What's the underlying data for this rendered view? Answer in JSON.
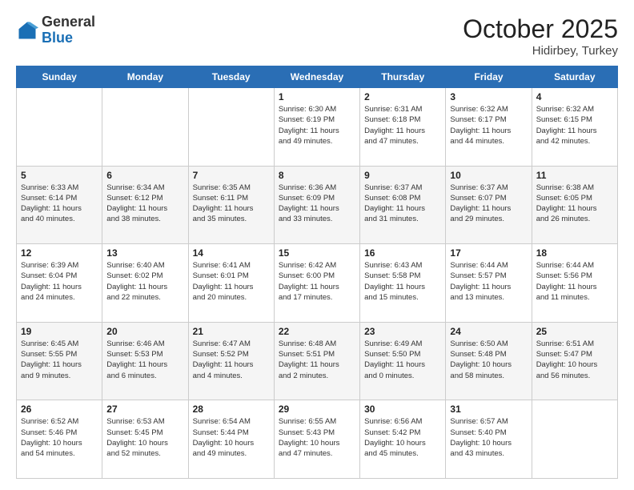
{
  "header": {
    "logo_general": "General",
    "logo_blue": "Blue",
    "month": "October 2025",
    "location": "Hidirbey, Turkey"
  },
  "days_of_week": [
    "Sunday",
    "Monday",
    "Tuesday",
    "Wednesday",
    "Thursday",
    "Friday",
    "Saturday"
  ],
  "weeks": [
    [
      {
        "day": "",
        "info": ""
      },
      {
        "day": "",
        "info": ""
      },
      {
        "day": "",
        "info": ""
      },
      {
        "day": "1",
        "info": "Sunrise: 6:30 AM\nSunset: 6:19 PM\nDaylight: 11 hours\nand 49 minutes."
      },
      {
        "day": "2",
        "info": "Sunrise: 6:31 AM\nSunset: 6:18 PM\nDaylight: 11 hours\nand 47 minutes."
      },
      {
        "day": "3",
        "info": "Sunrise: 6:32 AM\nSunset: 6:17 PM\nDaylight: 11 hours\nand 44 minutes."
      },
      {
        "day": "4",
        "info": "Sunrise: 6:32 AM\nSunset: 6:15 PM\nDaylight: 11 hours\nand 42 minutes."
      }
    ],
    [
      {
        "day": "5",
        "info": "Sunrise: 6:33 AM\nSunset: 6:14 PM\nDaylight: 11 hours\nand 40 minutes."
      },
      {
        "day": "6",
        "info": "Sunrise: 6:34 AM\nSunset: 6:12 PM\nDaylight: 11 hours\nand 38 minutes."
      },
      {
        "day": "7",
        "info": "Sunrise: 6:35 AM\nSunset: 6:11 PM\nDaylight: 11 hours\nand 35 minutes."
      },
      {
        "day": "8",
        "info": "Sunrise: 6:36 AM\nSunset: 6:09 PM\nDaylight: 11 hours\nand 33 minutes."
      },
      {
        "day": "9",
        "info": "Sunrise: 6:37 AM\nSunset: 6:08 PM\nDaylight: 11 hours\nand 31 minutes."
      },
      {
        "day": "10",
        "info": "Sunrise: 6:37 AM\nSunset: 6:07 PM\nDaylight: 11 hours\nand 29 minutes."
      },
      {
        "day": "11",
        "info": "Sunrise: 6:38 AM\nSunset: 6:05 PM\nDaylight: 11 hours\nand 26 minutes."
      }
    ],
    [
      {
        "day": "12",
        "info": "Sunrise: 6:39 AM\nSunset: 6:04 PM\nDaylight: 11 hours\nand 24 minutes."
      },
      {
        "day": "13",
        "info": "Sunrise: 6:40 AM\nSunset: 6:02 PM\nDaylight: 11 hours\nand 22 minutes."
      },
      {
        "day": "14",
        "info": "Sunrise: 6:41 AM\nSunset: 6:01 PM\nDaylight: 11 hours\nand 20 minutes."
      },
      {
        "day": "15",
        "info": "Sunrise: 6:42 AM\nSunset: 6:00 PM\nDaylight: 11 hours\nand 17 minutes."
      },
      {
        "day": "16",
        "info": "Sunrise: 6:43 AM\nSunset: 5:58 PM\nDaylight: 11 hours\nand 15 minutes."
      },
      {
        "day": "17",
        "info": "Sunrise: 6:44 AM\nSunset: 5:57 PM\nDaylight: 11 hours\nand 13 minutes."
      },
      {
        "day": "18",
        "info": "Sunrise: 6:44 AM\nSunset: 5:56 PM\nDaylight: 11 hours\nand 11 minutes."
      }
    ],
    [
      {
        "day": "19",
        "info": "Sunrise: 6:45 AM\nSunset: 5:55 PM\nDaylight: 11 hours\nand 9 minutes."
      },
      {
        "day": "20",
        "info": "Sunrise: 6:46 AM\nSunset: 5:53 PM\nDaylight: 11 hours\nand 6 minutes."
      },
      {
        "day": "21",
        "info": "Sunrise: 6:47 AM\nSunset: 5:52 PM\nDaylight: 11 hours\nand 4 minutes."
      },
      {
        "day": "22",
        "info": "Sunrise: 6:48 AM\nSunset: 5:51 PM\nDaylight: 11 hours\nand 2 minutes."
      },
      {
        "day": "23",
        "info": "Sunrise: 6:49 AM\nSunset: 5:50 PM\nDaylight: 11 hours\nand 0 minutes."
      },
      {
        "day": "24",
        "info": "Sunrise: 6:50 AM\nSunset: 5:48 PM\nDaylight: 10 hours\nand 58 minutes."
      },
      {
        "day": "25",
        "info": "Sunrise: 6:51 AM\nSunset: 5:47 PM\nDaylight: 10 hours\nand 56 minutes."
      }
    ],
    [
      {
        "day": "26",
        "info": "Sunrise: 6:52 AM\nSunset: 5:46 PM\nDaylight: 10 hours\nand 54 minutes."
      },
      {
        "day": "27",
        "info": "Sunrise: 6:53 AM\nSunset: 5:45 PM\nDaylight: 10 hours\nand 52 minutes."
      },
      {
        "day": "28",
        "info": "Sunrise: 6:54 AM\nSunset: 5:44 PM\nDaylight: 10 hours\nand 49 minutes."
      },
      {
        "day": "29",
        "info": "Sunrise: 6:55 AM\nSunset: 5:43 PM\nDaylight: 10 hours\nand 47 minutes."
      },
      {
        "day": "30",
        "info": "Sunrise: 6:56 AM\nSunset: 5:42 PM\nDaylight: 10 hours\nand 45 minutes."
      },
      {
        "day": "31",
        "info": "Sunrise: 6:57 AM\nSunset: 5:40 PM\nDaylight: 10 hours\nand 43 minutes."
      },
      {
        "day": "",
        "info": ""
      }
    ]
  ]
}
